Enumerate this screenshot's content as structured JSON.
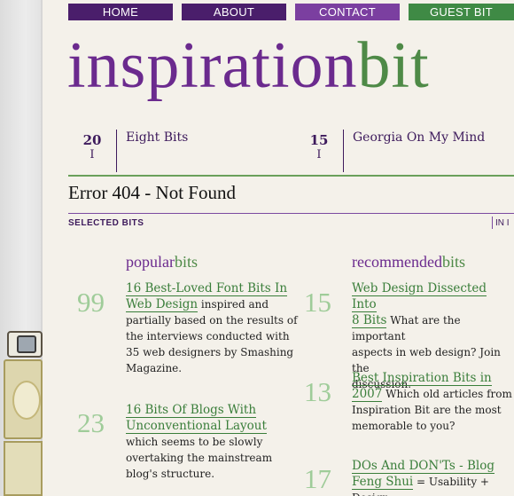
{
  "nav": {
    "home": "HOME",
    "about": "ABOUT",
    "contact": "CONTACT",
    "guest": "GUEST BIT"
  },
  "logo": {
    "part1": "inspiration",
    "part2": "bit"
  },
  "latest": [
    {
      "day": "20",
      "mark": "I",
      "title": "Eight Bits"
    },
    {
      "day": "15",
      "mark": "I",
      "title": "Georgia On My Mind"
    }
  ],
  "error_title": "Error 404 - Not Found",
  "selected_label": "SELECTED BITS",
  "in_label": "IN I",
  "popular": {
    "heading_a": "popular",
    "heading_b": "bits",
    "items": [
      {
        "count": "99",
        "title_l1": "16 Best-Loved Font Bits In",
        "title_l2": "Web Design",
        "desc_l1": " inspired and",
        "desc_l2": "partially based on the results of",
        "desc_l3": "the interviews conducted with",
        "desc_l4": "35 web designers by Smashing",
        "desc_l5": "Magazine."
      },
      {
        "count": "23",
        "title_l1": "16 Bits Of Blogs With",
        "title_l2": "Unconventional Layout",
        "desc_l1": "which seems to be slowly",
        "desc_l2": "overtaking the mainstream",
        "desc_l3": "blog's structure."
      }
    ]
  },
  "recommended": {
    "heading_a": "recommended",
    "heading_b": "bits",
    "items": [
      {
        "count": "15",
        "title_l1": "Web Design Dissected Into",
        "title_l2": "8 Bits",
        "desc_l1": " What are the important",
        "desc_l2": "aspects in web design? Join the",
        "desc_l3": "discussion."
      },
      {
        "count": "13",
        "title_l1": "Best Inspiration Bits in",
        "title_l2": "2007",
        "desc_l1": " Which old articles from",
        "desc_l2": "Inspiration Bit are the most",
        "desc_l3": "memorable to you?"
      },
      {
        "count": "17",
        "title_l1": "DOs And DON'Ts - Blog",
        "title_l2": "Feng Shui",
        "desc_l1": " = Usability + Design"
      }
    ]
  },
  "colors": {
    "nav_dark": "#4a1e6b",
    "nav_contact": "#7b3fa0",
    "nav_guest": "#3f8a45",
    "logo_purple": "#6b2a8e",
    "logo_green": "#4e8a47",
    "count_green": "#9fcc99"
  }
}
